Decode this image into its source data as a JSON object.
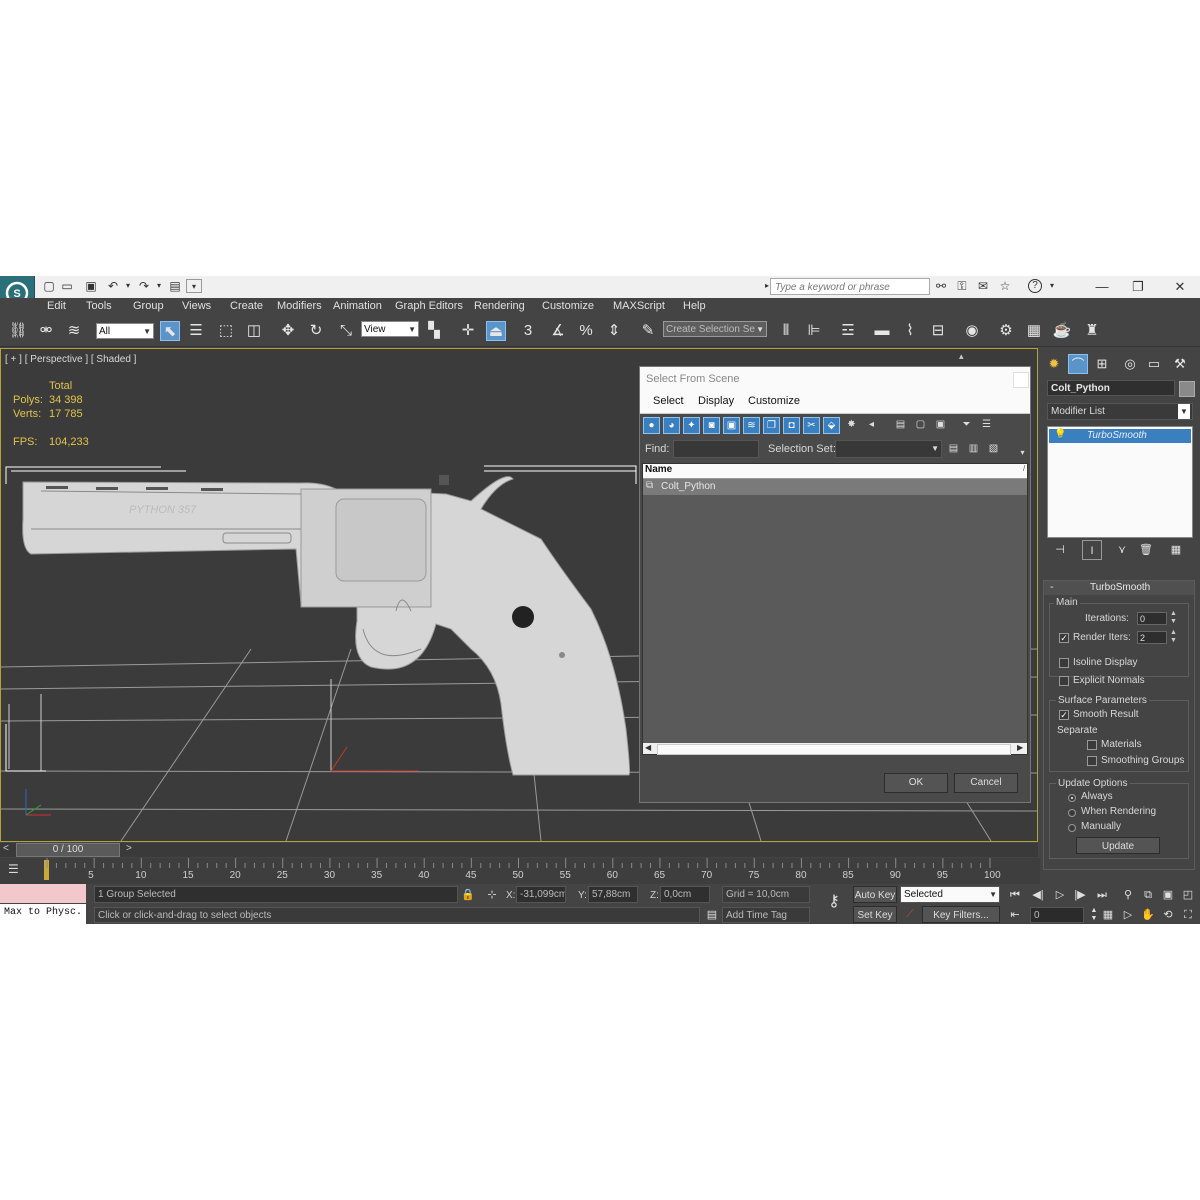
{
  "window": {
    "search_placeholder": "Type a keyword or phrase"
  },
  "menu": [
    "Edit",
    "Tools",
    "Group",
    "Views",
    "Create",
    "Modifiers",
    "Animation",
    "Graph Editors",
    "Rendering",
    "Customize",
    "MAXScript",
    "Help"
  ],
  "toolbar": {
    "selection_filter": "All",
    "reference_coord": "View",
    "snap_angle_label": "3",
    "named_selection_placeholder": "Create Selection Se"
  },
  "viewport": {
    "label": "[ + ] [ Perspective ] [ Shaded ]",
    "stats": {
      "total_label": "Total",
      "polys_label": "Polys:",
      "polys_value": "34 398",
      "verts_label": "Verts:",
      "verts_value": "17 785",
      "fps_label": "FPS:",
      "fps_value": "104,233"
    },
    "model_engraving": "PYTHON 357"
  },
  "dialog": {
    "title": "Select From Scene",
    "menu": [
      "Select",
      "Display",
      "Customize"
    ],
    "find_label": "Find:",
    "find_value": "",
    "selection_set_label": "Selection Set:",
    "column_name": "Name",
    "items": [
      "Colt_Python"
    ],
    "ok_label": "OK",
    "cancel_label": "Cancel"
  },
  "command_panel": {
    "object_name": "Colt_Python",
    "modifier_list_label": "Modifier List",
    "stack": [
      "TurboSmooth"
    ],
    "rollout_title": "TurboSmooth",
    "main_group": "Main",
    "iterations_label": "Iterations:",
    "iterations_value": "0",
    "render_iters_label": "Render Iters:",
    "render_iters_value": "2",
    "render_iters_checked": true,
    "isoline_label": "Isoline Display",
    "isoline_checked": false,
    "explicit_normals_label": "Explicit Normals",
    "explicit_normals_checked": false,
    "surface_group": "Surface Parameters",
    "smooth_result_label": "Smooth Result",
    "smooth_result_checked": true,
    "separate_label": "Separate",
    "materials_label": "Materials",
    "smoothing_groups_label": "Smoothing Groups",
    "update_group": "Update Options",
    "always_label": "Always",
    "when_rendering_label": "When Rendering",
    "manually_label": "Manually",
    "update_mode": "Always",
    "update_button": "Update"
  },
  "timeline": {
    "frame_display": "0 / 100",
    "ticks": [
      "0",
      "5",
      "10",
      "15",
      "20",
      "25",
      "30",
      "35",
      "40",
      "45",
      "50",
      "55",
      "60",
      "65",
      "70",
      "75",
      "80",
      "85",
      "90",
      "95",
      "100"
    ],
    "current_frame": 0
  },
  "status": {
    "maxscript_text": "Max to Physc.",
    "selection_info": "1 Group Selected",
    "prompt": "Click or click-and-drag to select objects",
    "x_label": "X:",
    "x_value": "-31,099cm",
    "y_label": "Y:",
    "y_value": "57,88cm",
    "z_label": "Z:",
    "z_value": "0,0cm",
    "grid": "Grid = 10,0cm",
    "add_time_tag": "Add Time Tag",
    "auto_key": "Auto Key",
    "set_key": "Set Key",
    "key_mode": "Selected",
    "key_filters": "Key Filters...",
    "frame_field": "0"
  },
  "colors": {
    "accent_blue": "#3a7fc0",
    "viewport_border": "#b5a33a",
    "stats_yellow": "#e0c54a",
    "maxscript_pink": "#f2c8cc"
  }
}
